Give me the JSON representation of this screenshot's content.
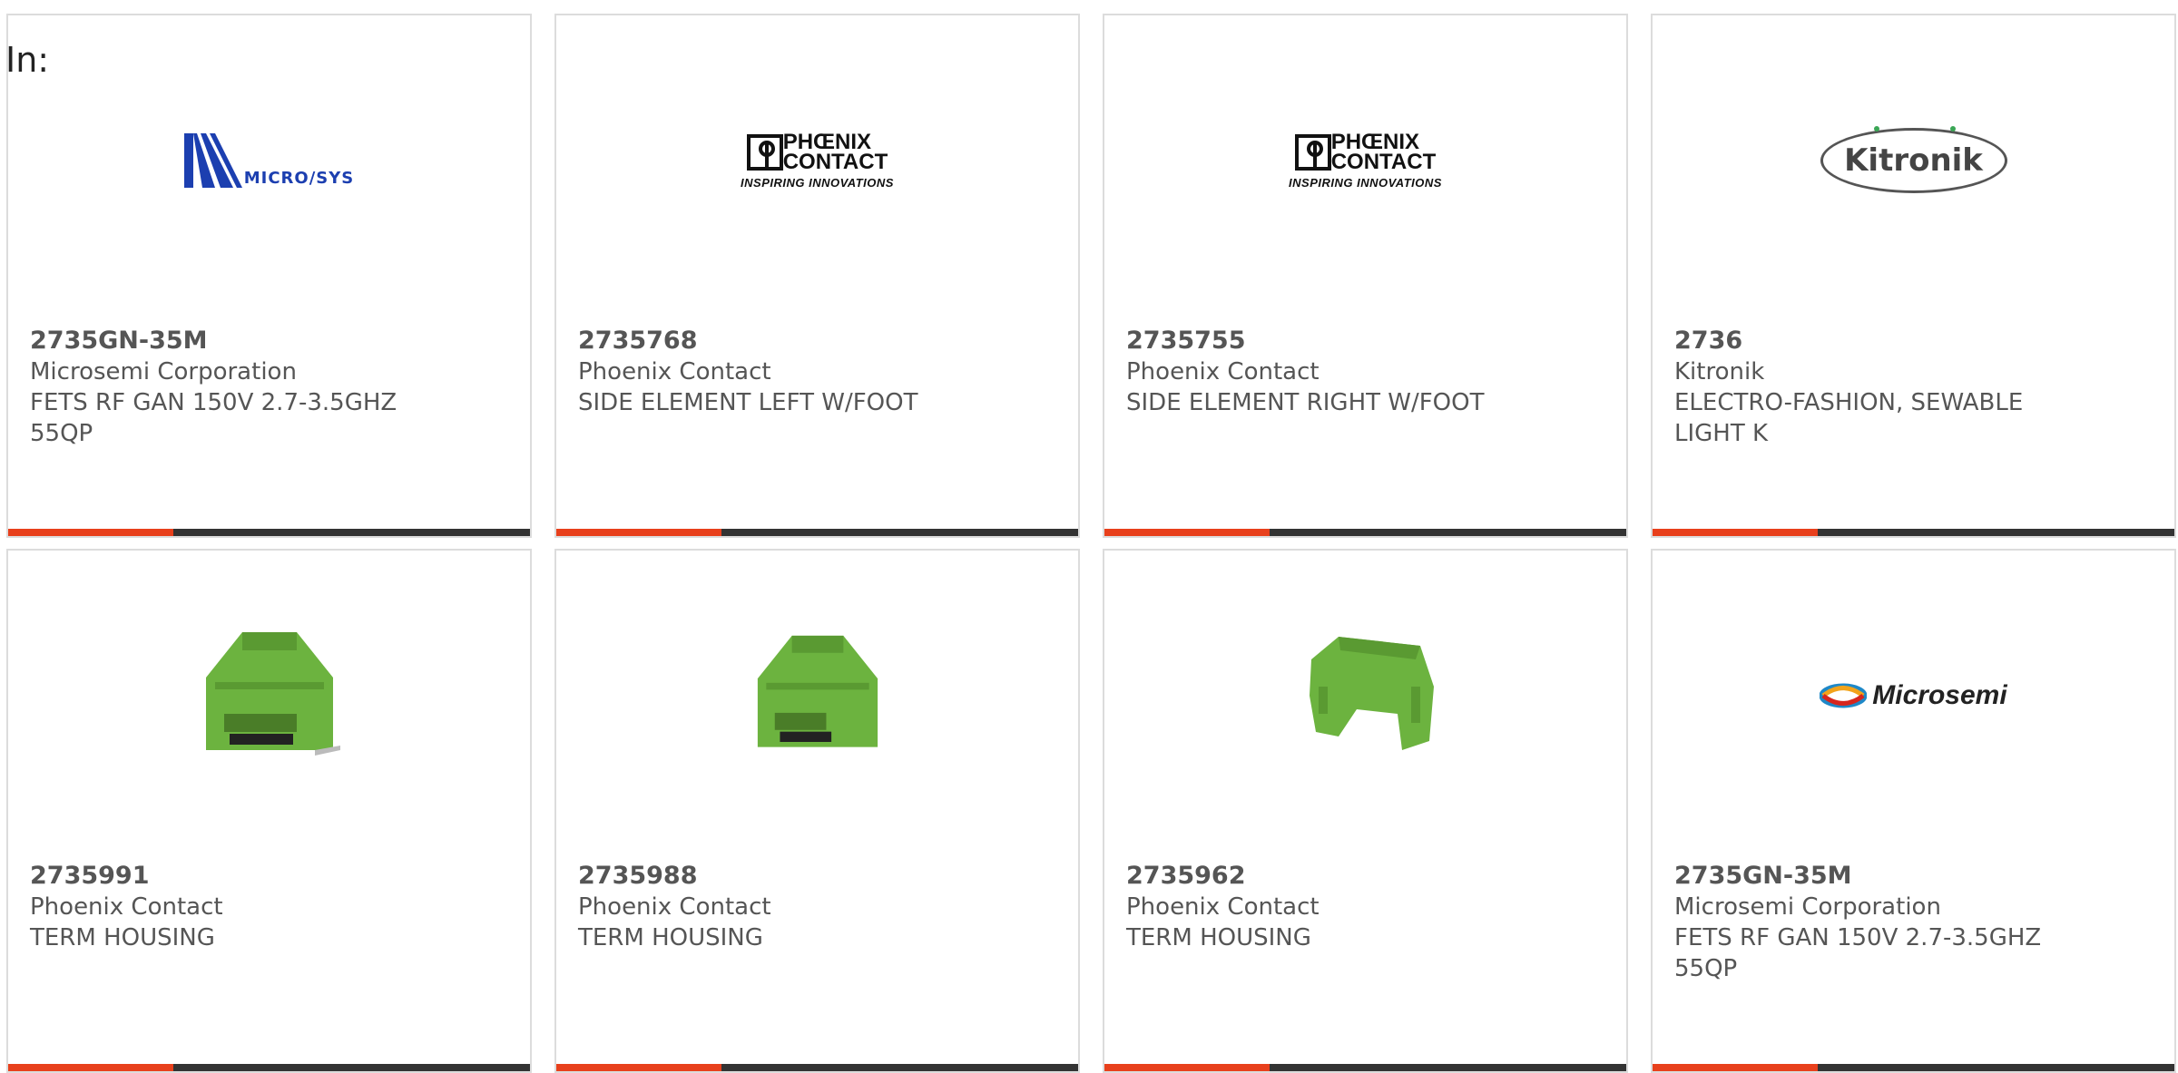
{
  "header": {
    "in_label": "In:"
  },
  "colors": {
    "accent": "#e8401c",
    "bar": "#333333",
    "text": "#555555",
    "housing_green": "#6cb33f"
  },
  "logos": {
    "microsys": "MICRO/SYS",
    "phoenix_name_1": "PHŒNIX",
    "phoenix_name_2": "CONTACT",
    "phoenix_tagline": "INSPIRING INNOVATIONS",
    "kitronik": "Kitronik",
    "microsemi": "Microsemi"
  },
  "cards": [
    {
      "part": "2735GN-35M",
      "maker": "Microsemi Corporation",
      "desc": "FETS RF GAN 150V 2.7-3.5GHZ 55QP",
      "image": "microsys-logo"
    },
    {
      "part": "2735768",
      "maker": "Phoenix Contact",
      "desc": "SIDE ELEMENT LEFT W/FOOT",
      "image": "phoenix-contact-logo"
    },
    {
      "part": "2735755",
      "maker": "Phoenix Contact",
      "desc": "SIDE ELEMENT RIGHT W/FOOT",
      "image": "phoenix-contact-logo"
    },
    {
      "part": "2736",
      "maker": "Kitronik",
      "desc": "ELECTRO-FASHION, SEWABLE LIGHT K",
      "image": "kitronik-logo"
    },
    {
      "part": "2735991",
      "maker": "Phoenix Contact",
      "desc": "TERM HOUSING",
      "image": "terminal-housing"
    },
    {
      "part": "2735988",
      "maker": "Phoenix Contact",
      "desc": "TERM HOUSING",
      "image": "terminal-housing"
    },
    {
      "part": "2735962",
      "maker": "Phoenix Contact",
      "desc": "TERM HOUSING",
      "image": "terminal-housing-side"
    },
    {
      "part": "2735GN-35M",
      "maker": "Microsemi Corporation",
      "desc": "FETS RF GAN 150V 2.7-3.5GHZ 55QP",
      "image": "microsemi-logo"
    }
  ]
}
